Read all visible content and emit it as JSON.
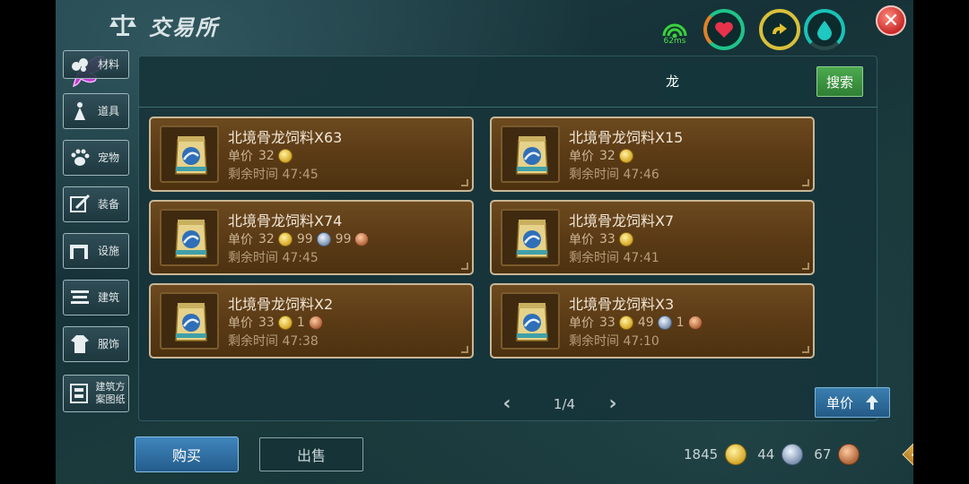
{
  "header": {
    "title": "交易所",
    "ping": "62ms"
  },
  "sidebar": {
    "items": [
      {
        "label": "材料",
        "icon": "materials-icon"
      },
      {
        "label": "道具",
        "icon": "tools-icon"
      },
      {
        "label": "宠物",
        "icon": "paw-icon"
      },
      {
        "label": "装备",
        "icon": "equipment-icon"
      },
      {
        "label": "设施",
        "icon": "facility-icon"
      },
      {
        "label": "建筑",
        "icon": "building-icon"
      },
      {
        "label": "服饰",
        "icon": "clothing-icon"
      },
      {
        "label": "建筑方案图纸",
        "icon": "blueprint-icon"
      }
    ]
  },
  "search": {
    "value": "龙",
    "button_label": "搜索"
  },
  "listing_labels": {
    "unit_price": "单价",
    "time_left": "剩余时间"
  },
  "listings": [
    {
      "name": "北境骨龙饲料X63",
      "gold": "32",
      "silver": "",
      "copper": "",
      "time": "47:45"
    },
    {
      "name": "北境骨龙饲料X15",
      "gold": "32",
      "silver": "",
      "copper": "",
      "time": "47:46"
    },
    {
      "name": "北境骨龙饲料X74",
      "gold": "32",
      "silver": "99",
      "copper": "99",
      "time": "47:45"
    },
    {
      "name": "北境骨龙饲料X7",
      "gold": "33",
      "silver": "",
      "copper": "",
      "time": "47:41"
    },
    {
      "name": "北境骨龙饲料X2",
      "gold": "33",
      "silver": "",
      "copper": "1",
      "time": "47:38"
    },
    {
      "name": "北境骨龙饲料X3",
      "gold": "33",
      "silver": "49",
      "copper": "1",
      "time": "47:10"
    }
  ],
  "pagination": {
    "text": "1/4"
  },
  "sort": {
    "label": "单价"
  },
  "footer": {
    "buy_label": "购买",
    "sell_label": "出售"
  },
  "wallet": {
    "gold": "1845",
    "silver": "44",
    "copper": "67"
  },
  "colors": {
    "card_bg": "#5b3b16",
    "card_border": "#c9b796",
    "panel_bg": "#16343a",
    "search_button": "#2f7f33",
    "primary_button": "#245c8c"
  }
}
